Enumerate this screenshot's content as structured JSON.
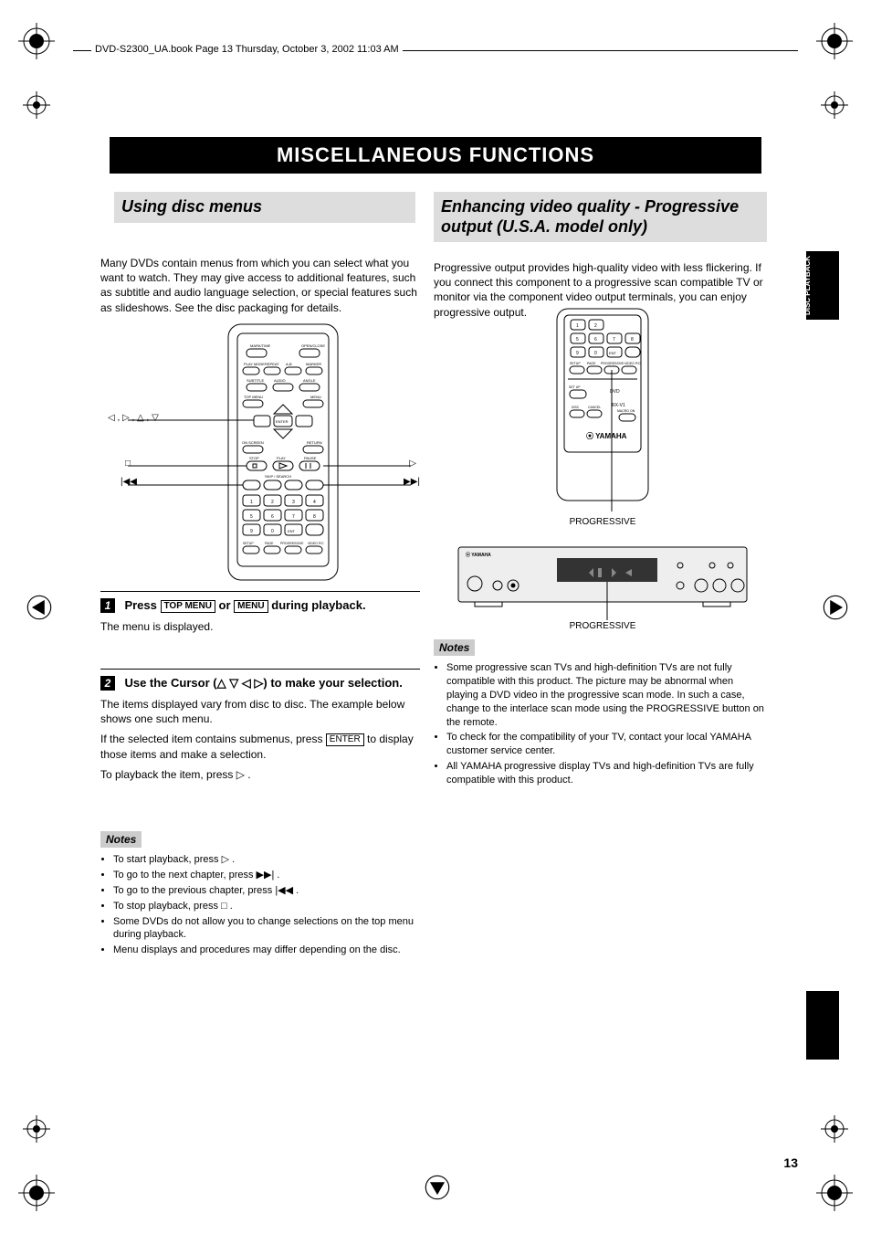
{
  "header": "DVD-S2300_UA.book  Page 13  Thursday, October 3, 2002  11:03 AM",
  "chapter_title": "MISCELLANEOUS FUNCTIONS",
  "page_number": "13",
  "side_tab_label": "DISC PLAYBACK",
  "left": {
    "section_title": "Using disc menus",
    "intro": "Many DVDs contain menus from which you can select what you want to watch. They may give access to additional features, such as subtitle and audio language selection, or special features such as slideshows. See the disc packaging for details.",
    "arrow_labels": {
      "left": "◁ , ▷ , △ , ▽",
      "stop": "□",
      "prev": "|◀◀",
      "play": "▷",
      "next": "▶▶|"
    },
    "step1_head_a": "Press",
    "step1_key_top": "TOP MENU",
    "step1_head_b": "or",
    "step1_key_menu": "MENU",
    "step1_head_c": "during playback.",
    "step1_body": "The menu is displayed.",
    "step2_head": "Use the Cursor (△ ▽ ◁ ▷) to make your selection.",
    "step2_body_a": "The items displayed vary from disc to disc. The example below shows one such menu.",
    "step2_key_enter": "ENTER",
    "step2_body_b": "If the selected item contains submenus, press ENTER to display those items and make a selection.",
    "step2_body_c": "To playback the item, press ▷ .",
    "notes_title": "Notes",
    "notes": [
      "To start playback, press ▷ .",
      "To go to the next chapter, press ▶▶| .",
      "To go to the previous chapter, press |◀◀ .",
      "To stop playback, press □ .",
      "Some DVDs do not allow you to change selections on the top menu during playback.",
      "Menu displays and procedures may differ depending on the disc."
    ]
  },
  "right": {
    "section_title": "Enhancing video quality - Progressive output (U.S.A. model only)",
    "intro": "Progressive output provides high-quality video with less flickering. If you connect this component to a progressive scan compatible TV or monitor via the component video output terminals, you can enjoy progressive output.",
    "fig_caption_remote": "PROGRESSIVE",
    "fig_caption_player": "PROGRESSIVE",
    "brand": "YAMAHA",
    "notes_title": "Notes",
    "notes": [
      "Some progressive scan TVs and high-definition TVs are not fully compatible with this product. The picture may be abnormal when playing a DVD video in the progressive scan mode. In such a case, change to the interlace scan mode using the PROGRESSIVE button on the remote.",
      "To check for the compatibility of your TV, contact your local YAMAHA customer service center.",
      "All YAMAHA progressive display TVs and high-definition TVs are fully compatible with this product."
    ]
  }
}
